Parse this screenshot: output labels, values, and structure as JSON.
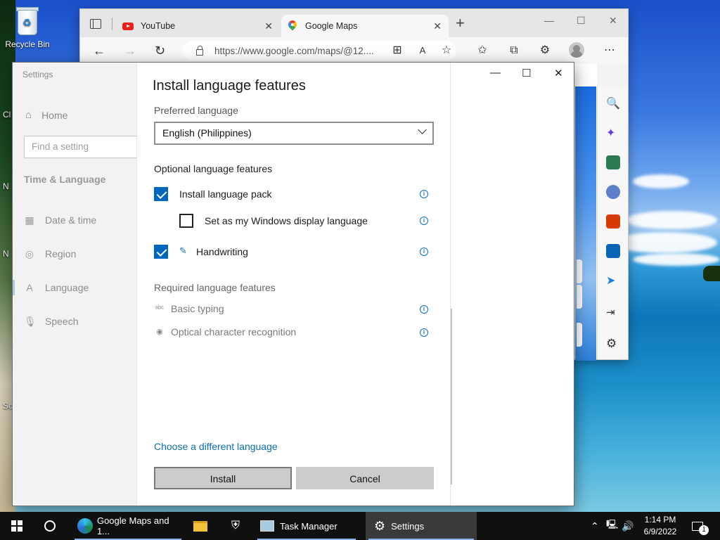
{
  "desktop": {
    "recycle_bin_label": "Recycle Bin",
    "fragments": [
      "Cl",
      "N",
      "N",
      "Sc"
    ]
  },
  "browser": {
    "tabs": [
      {
        "label": "YouTube",
        "icon": "youtube-icon"
      },
      {
        "label": "Google Maps",
        "icon": "google-maps-icon"
      }
    ],
    "url": "https://www.google.com/maps/@12....",
    "new_tab_glyph": "+",
    "controls": {
      "minimize": "—",
      "maximize": "☐",
      "close": "✕"
    }
  },
  "settings": {
    "window_title": "Settings",
    "sidebar": {
      "home_label": "Home",
      "search_placeholder": "Find a setting",
      "section_title": "Time & Language",
      "items": [
        {
          "label": "Date & time",
          "icon": "calendar-clock-icon"
        },
        {
          "label": "Region",
          "icon": "globe-icon"
        },
        {
          "label": "Language",
          "icon": "language-icon",
          "selected": true
        },
        {
          "label": "Speech",
          "icon": "microphone-icon"
        }
      ]
    },
    "dialog": {
      "title": "Install language features",
      "preferred_language_label": "Preferred language",
      "preferred_language_value": "English (Philippines)",
      "optional_header": "Optional language features",
      "optional_features": [
        {
          "label": "Install language pack",
          "checked": true
        },
        {
          "label": "Set as my Windows display language",
          "checked": false
        },
        {
          "label": "Handwriting",
          "checked": true
        }
      ],
      "required_header": "Required language features",
      "required_features": [
        {
          "label": "Basic typing",
          "icon": "abc-typing-icon"
        },
        {
          "label": "Optical character recognition",
          "icon": "ocr-icon"
        }
      ],
      "choose_link": "Choose a different language",
      "install_button": "Install",
      "cancel_button": "Cancel"
    }
  },
  "taskbar": {
    "items": [
      {
        "label": "Google Maps and 1...",
        "icon": "edge-dev-icon"
      },
      {
        "label": "",
        "icon": "file-explorer-icon"
      },
      {
        "label": "",
        "icon": "security-shield-icon"
      },
      {
        "label": "Task Manager",
        "icon": "task-manager-icon"
      },
      {
        "label": "Settings",
        "icon": "gear-icon",
        "active": true
      }
    ],
    "time": "1:14 PM",
    "date": "6/9/2022",
    "notification_count": "1"
  },
  "colors": {
    "accent": "#0067c0",
    "link": "#0b6fa8",
    "taskbar": "#101010"
  }
}
